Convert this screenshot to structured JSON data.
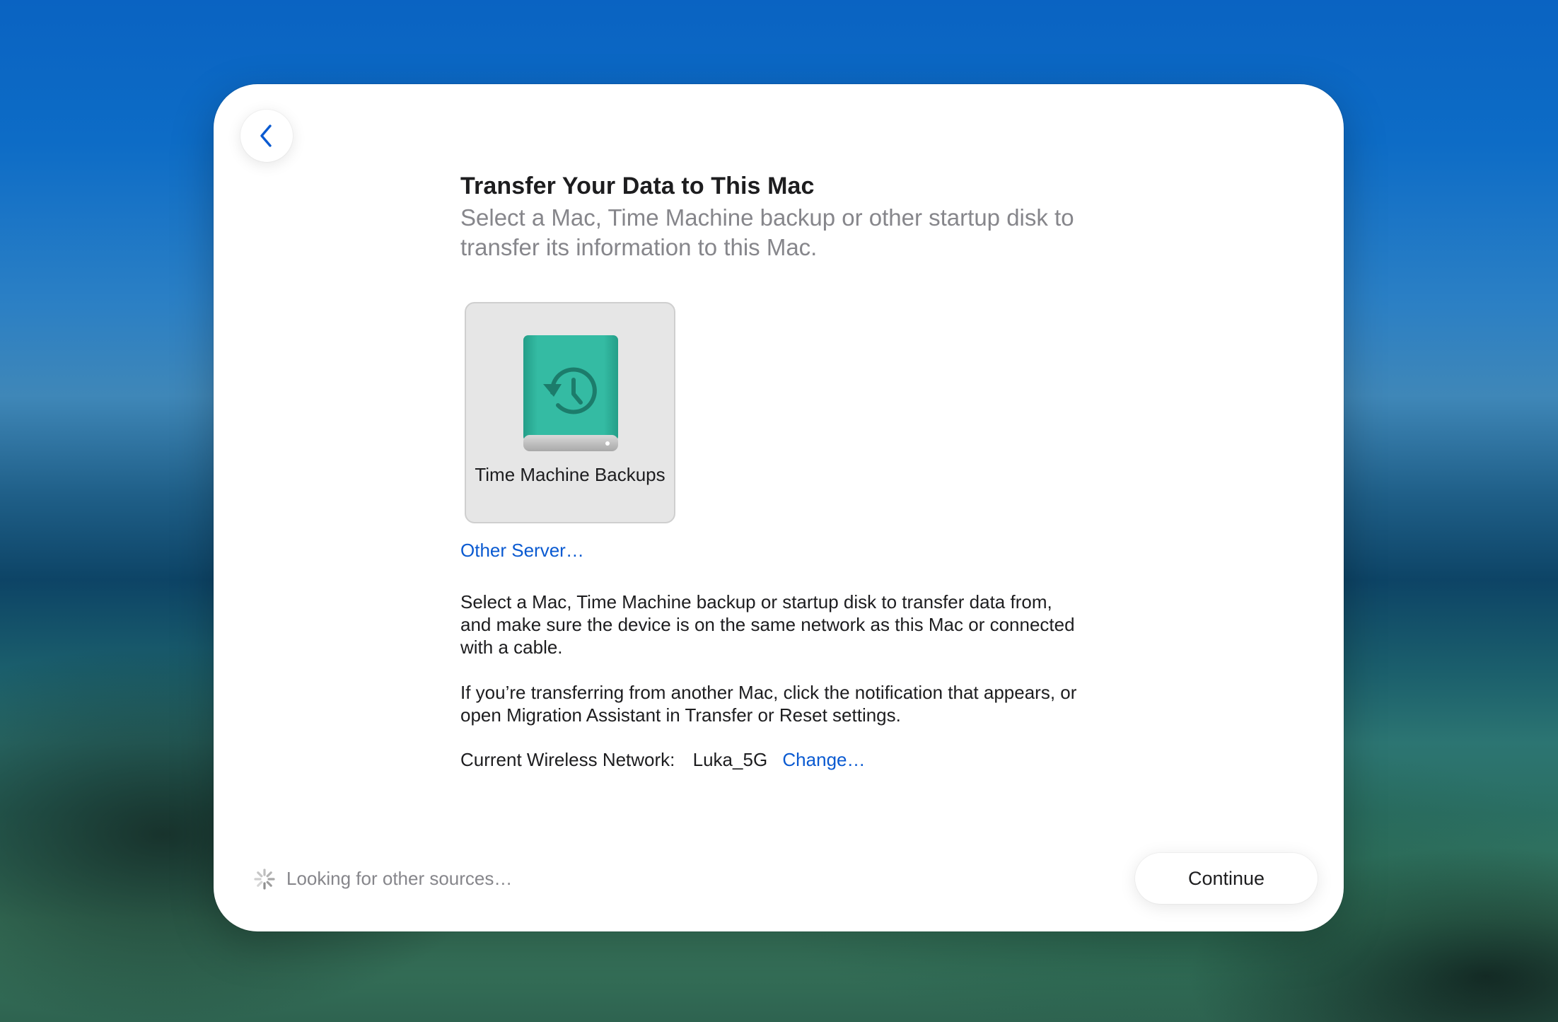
{
  "colors": {
    "accent": "#0a5ad1",
    "drive_teal": "#2fb39c",
    "window_bg": "#ffffff",
    "secondary_text": "#86868b"
  },
  "back_button": {
    "icon": "chevron-left-icon"
  },
  "header": {
    "title": "Transfer Your Data to This Mac",
    "subtitle": "Select a Mac, Time Machine backup or other startup disk to transfer its information to this Mac."
  },
  "sources": [
    {
      "label": "Time Machine Backups",
      "icon": "time-machine-drive-icon"
    }
  ],
  "other_server_link": "Other Server…",
  "info": {
    "paragraph_1": "Select a Mac, Time Machine backup or startup disk to transfer data from, and make sure the device is on the same network as this Mac or connected with a cable.",
    "paragraph_2": "If you’re transferring from another Mac, click the notification that appears, or open Migration Assistant in Transfer or Reset settings."
  },
  "network": {
    "label": "Current Wireless Network:",
    "value": "Luka_5G",
    "change_link": "Change…"
  },
  "footer": {
    "status_icon": "spinner-icon",
    "status_text": "Looking for other sources…",
    "continue_label": "Continue"
  }
}
